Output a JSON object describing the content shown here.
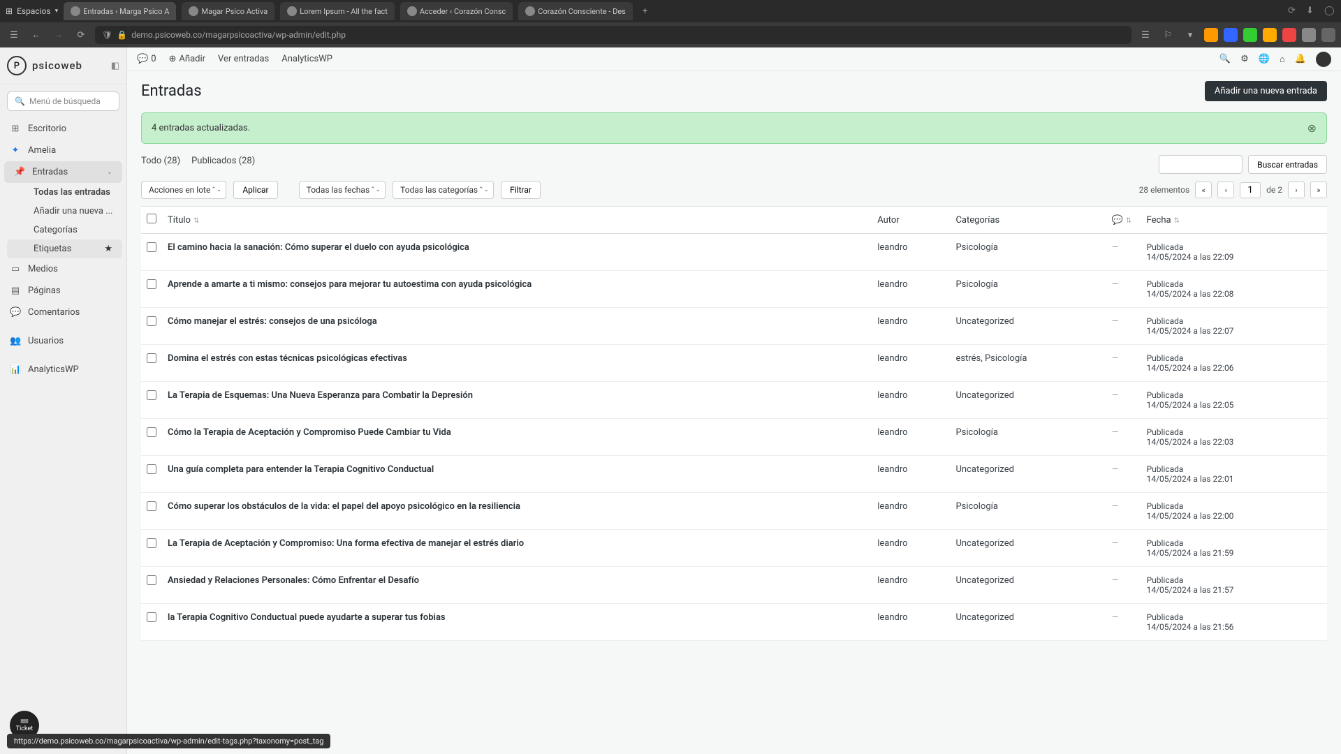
{
  "browser": {
    "spaces_label": "Espacios",
    "tabs": [
      "Entradas ‹ Marga Psico A",
      "Magar Psico Activa",
      "Lorem Ipsum - All the fact",
      "Acceder ‹ Corazón Consc",
      "Corazón Consciente - Des"
    ],
    "url": "demo.psicoweb.co/magarpsicoactiva/wp-admin/edit.php"
  },
  "logo_text": "psicoweb",
  "search_placeholder": "Menú de búsqueda",
  "nav": {
    "desktop": "Escritorio",
    "amelia": "Amelia",
    "entries": "Entradas",
    "media": "Medios",
    "pages": "Páginas",
    "comments": "Comentarios",
    "users": "Usuarios",
    "analytics": "AnalyticsWP"
  },
  "subnav": {
    "all": "Todas las entradas",
    "add": "Añadir una nueva ...",
    "categories": "Categorías",
    "tags": "Etiquetas"
  },
  "admin_bar": {
    "comments": "0",
    "add": "Añadir",
    "view": "Ver entradas",
    "analytics": "AnalyticsWP"
  },
  "page": {
    "title": "Entradas",
    "add_new": "Añadir una nueva entrada",
    "notice": "4 entradas actualizadas.",
    "filter_all": "Todo (28)",
    "filter_pub": "Publicados (28)",
    "bulk_action": "Acciones en lote",
    "apply": "Aplicar",
    "all_dates": "Todas las fechas",
    "all_cats": "Todas las categorías",
    "filter": "Filtrar",
    "search_btn": "Buscar entradas",
    "count": "28 elementos",
    "page_num": "1",
    "of": "de 2"
  },
  "cols": {
    "title": "Título",
    "author": "Autor",
    "cats": "Categorías",
    "date": "Fecha"
  },
  "rows": [
    {
      "title": "El camino hacia la sanación: Cómo superar el duelo con ayuda psicológica",
      "author": "leandro",
      "cat": "Psicología",
      "status": "Publicada",
      "date": "14/05/2024 a las 22:09"
    },
    {
      "title": "Aprende a amarte a ti mismo: consejos para mejorar tu autoestima con ayuda psicológica",
      "author": "leandro",
      "cat": "Psicología",
      "status": "Publicada",
      "date": "14/05/2024 a las 22:08"
    },
    {
      "title": "Cómo manejar el estrés: consejos de una psicóloga",
      "author": "leandro",
      "cat": "Uncategorized",
      "status": "Publicada",
      "date": "14/05/2024 a las 22:07"
    },
    {
      "title": "Domina el estrés con estas técnicas psicológicas efectivas",
      "author": "leandro",
      "cat": "estrés, Psicología",
      "status": "Publicada",
      "date": "14/05/2024 a las 22:06"
    },
    {
      "title": "La Terapia de Esquemas: Una Nueva Esperanza para Combatir la Depresión",
      "author": "leandro",
      "cat": "Uncategorized",
      "status": "Publicada",
      "date": "14/05/2024 a las 22:05"
    },
    {
      "title": "Cómo la Terapia de Aceptación y Compromiso Puede Cambiar tu Vida",
      "author": "leandro",
      "cat": "Psicología",
      "status": "Publicada",
      "date": "14/05/2024 a las 22:03"
    },
    {
      "title": "Una guía completa para entender la Terapia Cognitivo Conductual",
      "author": "leandro",
      "cat": "Uncategorized",
      "status": "Publicada",
      "date": "14/05/2024 a las 22:01"
    },
    {
      "title": "Cómo superar los obstáculos de la vida: el papel del apoyo psicológico en la resiliencia",
      "author": "leandro",
      "cat": "Psicología",
      "status": "Publicada",
      "date": "14/05/2024 a las 22:00"
    },
    {
      "title": "La Terapia de Aceptación y Compromiso: Una forma efectiva de manejar el estrés diario",
      "author": "leandro",
      "cat": "Uncategorized",
      "status": "Publicada",
      "date": "14/05/2024 a las 21:59"
    },
    {
      "title": "Ansiedad y Relaciones Personales: Cómo Enfrentar el Desafío",
      "author": "leandro",
      "cat": "Uncategorized",
      "status": "Publicada",
      "date": "14/05/2024 a las 21:57"
    },
    {
      "title": "la Terapia Cognitivo Conductual puede ayudarte a superar tus fobias",
      "author": "leandro",
      "cat": "Uncategorized",
      "status": "Publicada",
      "date": "14/05/2024 a las 21:56"
    }
  ],
  "ticket": "Ticket",
  "status_url": "https://demo.psicoweb.co/magarpsicoactiva/wp-admin/edit-tags.php?taxonomy=post_tag"
}
